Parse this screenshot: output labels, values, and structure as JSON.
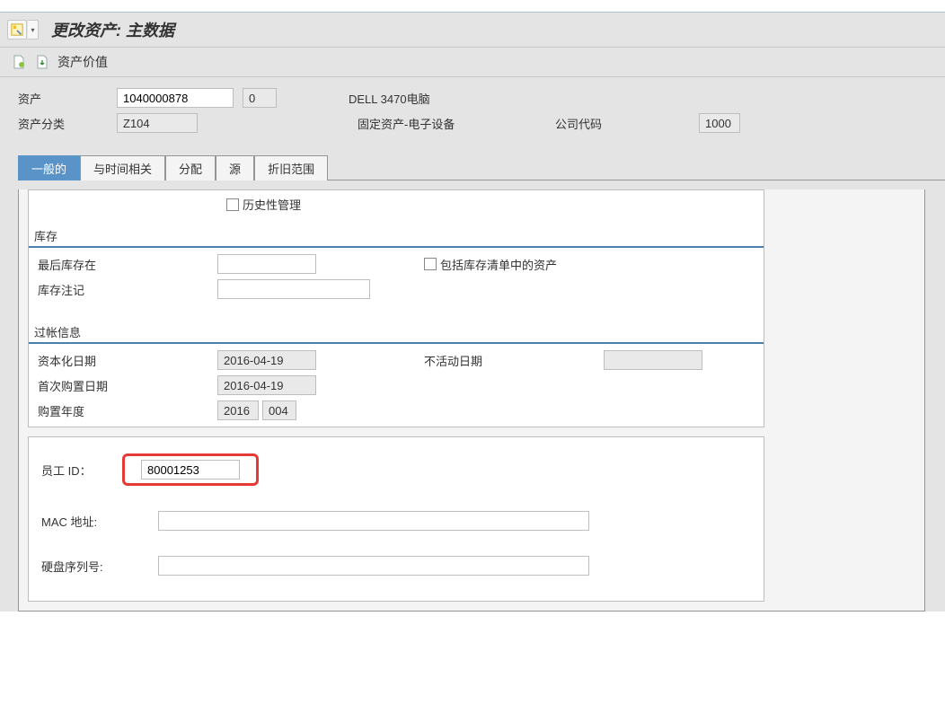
{
  "page": {
    "title": "更改资产: 主数据",
    "sub_label": "资产价值"
  },
  "header": {
    "asset_label": "资产",
    "asset_value": "1040000878",
    "sub_value": "0",
    "desc_text": "DELL 3470电脑",
    "class_label": "资产分类",
    "class_value": "Z104",
    "class_desc": "固定资产-电子设备",
    "company_label": "公司代码",
    "company_value": "1000"
  },
  "tabs": {
    "general": "一般的",
    "time": "与时间相关",
    "assign": "分配",
    "origin": "源",
    "deprec": "折旧范围"
  },
  "general": {
    "history_mgmt": "历史性管理",
    "inventory_section": "库存",
    "last_inventory_label": "最后库存在",
    "last_inventory_value": "",
    "include_asset_label": "包括库存清单中的资产",
    "inventory_note_label": "库存注记",
    "inventory_note_value": "",
    "posting_section": "过帐信息",
    "cap_date_label": "资本化日期",
    "cap_date_value": "2016-04-19",
    "inactive_date_label": "不活动日期",
    "inactive_date_value": "",
    "first_acq_label": "首次购置日期",
    "first_acq_value": "2016-04-19",
    "acq_year_label": "购置年度",
    "acq_year_value": "2016",
    "acq_period_value": "004",
    "emp_id_label": "员工 ID：",
    "emp_id_value": "80001253",
    "mac_label": "MAC 地址:",
    "mac_value": "",
    "hdd_label": "硬盘序列号:",
    "hdd_value": ""
  }
}
